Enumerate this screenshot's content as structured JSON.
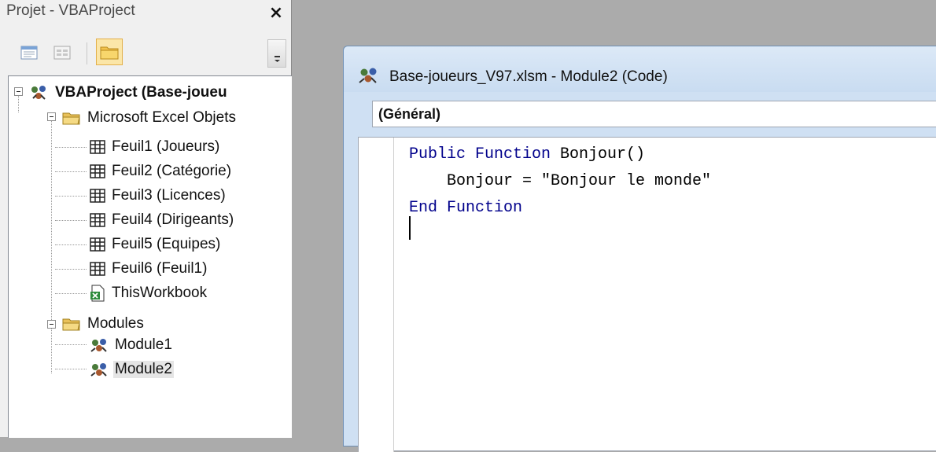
{
  "project_pane": {
    "title": "Projet - VBAProject",
    "close_glyph": "×",
    "toolbar": {
      "view_code_icon": "view-code-icon",
      "view_object_icon": "view-object-icon",
      "toggle_folders_icon": "folder-icon"
    },
    "tree": {
      "root": "VBAProject (Base-joueu",
      "groups": [
        {
          "label": "Microsoft Excel Objets",
          "items": [
            "Feuil1 (Joueurs)",
            "Feuil2 (Catégorie)",
            "Feuil3 (Licences)",
            "Feuil4 (Dirigeants)",
            "Feuil5 (Equipes)",
            "Feuil6 (Feuil1)",
            "ThisWorkbook"
          ]
        },
        {
          "label": "Modules",
          "items": [
            "Module1",
            "Module2"
          ]
        }
      ],
      "selected": "Module2"
    }
  },
  "code_window": {
    "title": "Base-joueurs_V97.xlsm - Module2 (Code)",
    "object_combo": "(Général)",
    "code": {
      "line1_kw": "Public Function",
      "line1_rest": " Bonjour()",
      "line2": "    Bonjour = \"Bonjour le monde\"",
      "line3_kw": "End Function"
    }
  },
  "colors": {
    "keyword": "#00008b",
    "mdi_background": "#ababab",
    "code_window_frame": "#cfe0f3"
  }
}
